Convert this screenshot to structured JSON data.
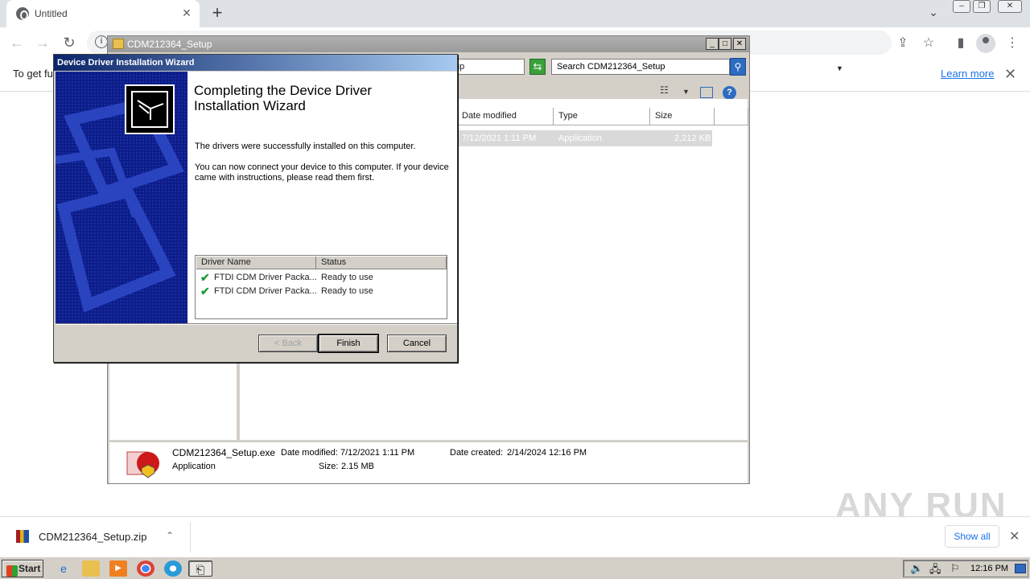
{
  "browser": {
    "tab_title": "Untitled",
    "infobar_text": "To get fu",
    "learn_more": "Learn more"
  },
  "explorer": {
    "title": "CDM212364_Setup",
    "address_partial": "up",
    "search_placeholder": "Search CDM212364_Setup",
    "columns": [
      "Date modified",
      "Type",
      "Size"
    ],
    "file_row": {
      "date": "7/12/2021 1:11 PM",
      "type": "Application",
      "size": "2,212 KB"
    },
    "details": {
      "filename": "CDM212364_Setup.exe",
      "filetype": "Application",
      "date_modified_label": "Date modified:",
      "date_modified": "7/12/2021 1:11 PM",
      "size_label": "Size:",
      "size": "2.15 MB",
      "date_created_label": "Date created:",
      "date_created": "2/14/2024 12:16 PM"
    }
  },
  "wizard": {
    "title": "Device Driver Installation Wizard",
    "heading": "Completing the Device Driver Installation Wizard",
    "text1": "The drivers were successfully installed on this computer.",
    "text2": "You can now connect your device to this computer. If your device came with instructions, please read them first.",
    "list_headers": [
      "Driver Name",
      "Status"
    ],
    "drivers": [
      {
        "name": "FTDI CDM Driver Packa...",
        "status": "Ready to use"
      },
      {
        "name": "FTDI CDM Driver Packa...",
        "status": "Ready to use"
      }
    ],
    "buttons": {
      "back": "< Back",
      "finish": "Finish",
      "cancel": "Cancel"
    }
  },
  "downloads": {
    "file": "CDM212364_Setup.zip",
    "show_all": "Show all"
  },
  "watermark": "ANY RUN",
  "taskbar": {
    "start": "Start",
    "clock": "12:16 PM"
  }
}
